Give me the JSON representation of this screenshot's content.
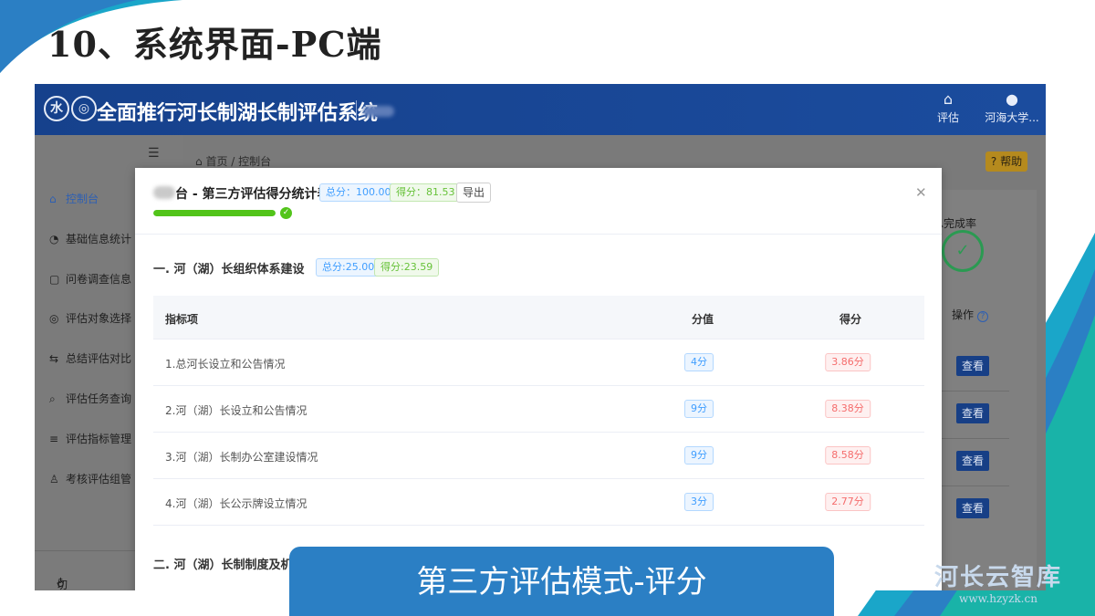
{
  "slide": {
    "title": "10、系统界面-PC端",
    "caption": "第三方评估模式-评分",
    "watermark_main": "河长云智库",
    "watermark_url": "www.hzyzk.cn"
  },
  "header": {
    "app_title": "全面推行河长制湖长制评估系统",
    "eval_label": "评估",
    "user_label": "河海大学..."
  },
  "sidebar": {
    "items": [
      {
        "label": "控制台",
        "icon": "home-icon"
      },
      {
        "label": "基础信息统计",
        "icon": "pie-chart-icon"
      },
      {
        "label": "问卷调查信息",
        "icon": "document-icon"
      },
      {
        "label": "评估对象选择",
        "icon": "check-circle-icon"
      },
      {
        "label": "总结评估对比",
        "icon": "swap-icon"
      },
      {
        "label": "评估任务查询",
        "icon": "search-icon"
      },
      {
        "label": "评估指标管理",
        "icon": "list-icon"
      },
      {
        "label": "考核评估组管",
        "icon": "users-icon"
      }
    ],
    "footer_label": "切换主题"
  },
  "content": {
    "breadcrumb_home": "首页",
    "breadcrumb_current": "控制台",
    "help_label": "帮助",
    "completion_label": "总完成率",
    "operation_label": "操作",
    "view_label": "查看"
  },
  "modal": {
    "title": "台 - 第三方评估得分统计表",
    "total_tag": "总分：100.00",
    "score_tag": "得分：81.53",
    "export_label": "导出",
    "progress_percent": 100,
    "section1": {
      "title": "一. 河（湖）长组织体系建设",
      "total_tag": "总分:25.00",
      "score_tag": "得分:23.59"
    },
    "table": {
      "headers": {
        "name": "指标项",
        "value": "分值",
        "score": "得分"
      },
      "rows": [
        {
          "name": "1.总河长设立和公告情况",
          "value": "4分",
          "score": "3.86分"
        },
        {
          "name": "2.河（湖）长设立和公告情况",
          "value": "9分",
          "score": "8.38分"
        },
        {
          "name": "3.河（湖）长制办公室建设情况",
          "value": "9分",
          "score": "8.58分"
        },
        {
          "name": "4.河（湖）长公示牌设立情况",
          "value": "3分",
          "score": "2.77分"
        }
      ]
    },
    "section2_title": "二. 河（湖）长制制度及机"
  },
  "colors": {
    "header_blue": "#16418c",
    "caption_blue": "#2b7fc4",
    "tag_blue": "#409eff",
    "tag_green": "#67c23a",
    "tag_red": "#f56c6c",
    "progress_green": "#52c41a"
  }
}
